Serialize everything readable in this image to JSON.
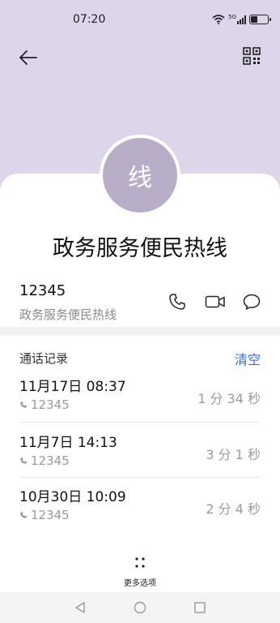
{
  "status_bar": {
    "time": "07:20",
    "signal_label": "5G",
    "battery_level": 0.35
  },
  "contact": {
    "avatar_char": "线",
    "name": "政务服务便民热线",
    "phone_number": "12345",
    "phone_label": "政务服务便民热线"
  },
  "call_log": {
    "title": "通话记录",
    "clear_label": "清空",
    "entries": [
      {
        "datetime": "11月17日 08:37",
        "number": "12345",
        "duration": "1 分 34 秒"
      },
      {
        "datetime": "11月7日 14:13",
        "number": "12345",
        "duration": "3 分 1 秒"
      },
      {
        "datetime": "10月30日 10:09",
        "number": "12345",
        "duration": "2 分 4 秒"
      }
    ]
  },
  "more_options_label": "更多选项",
  "colors": {
    "header_bg": "#ddd5ea",
    "avatar_bg": "#b9aec8",
    "accent": "#2f6fe0"
  },
  "icons": [
    "back-arrow-icon",
    "qr-code-icon",
    "phone-icon",
    "video-call-icon",
    "message-icon",
    "phone-small-icon",
    "more-dots-icon",
    "nav-back-icon",
    "nav-home-icon",
    "nav-recents-icon",
    "wifi-icon",
    "signal-icon",
    "battery-icon"
  ]
}
